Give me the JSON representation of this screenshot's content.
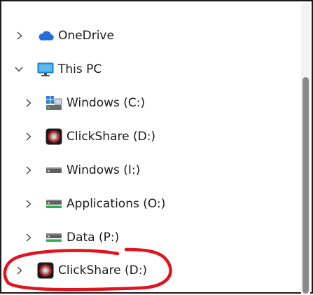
{
  "tree": {
    "items": [
      {
        "label": "OneDrive",
        "icon": "onedrive-cloud-icon",
        "expanded": false
      },
      {
        "label": "This PC",
        "icon": "monitor-icon",
        "expanded": true
      },
      {
        "label": "Windows (C:)",
        "icon": "windows-drive-icon",
        "expanded": false
      },
      {
        "label": "ClickShare (D:)",
        "icon": "clickshare-drive-icon",
        "expanded": false
      },
      {
        "label": "Windows (I:)",
        "icon": "hard-drive-icon",
        "expanded": false
      },
      {
        "label": "Applications (O:)",
        "icon": "hard-drive-green-icon",
        "expanded": false
      },
      {
        "label": "Data (P:)",
        "icon": "hard-drive-green-icon",
        "expanded": false
      },
      {
        "label": "ClickShare (D:)",
        "icon": "clickshare-drive-icon",
        "expanded": false,
        "annotated": true
      }
    ]
  },
  "colors": {
    "annotation": "#e0141e",
    "onedrive": "#1f6fd6",
    "monitor": "#2f9be0",
    "drive_green": "#22b14c"
  }
}
